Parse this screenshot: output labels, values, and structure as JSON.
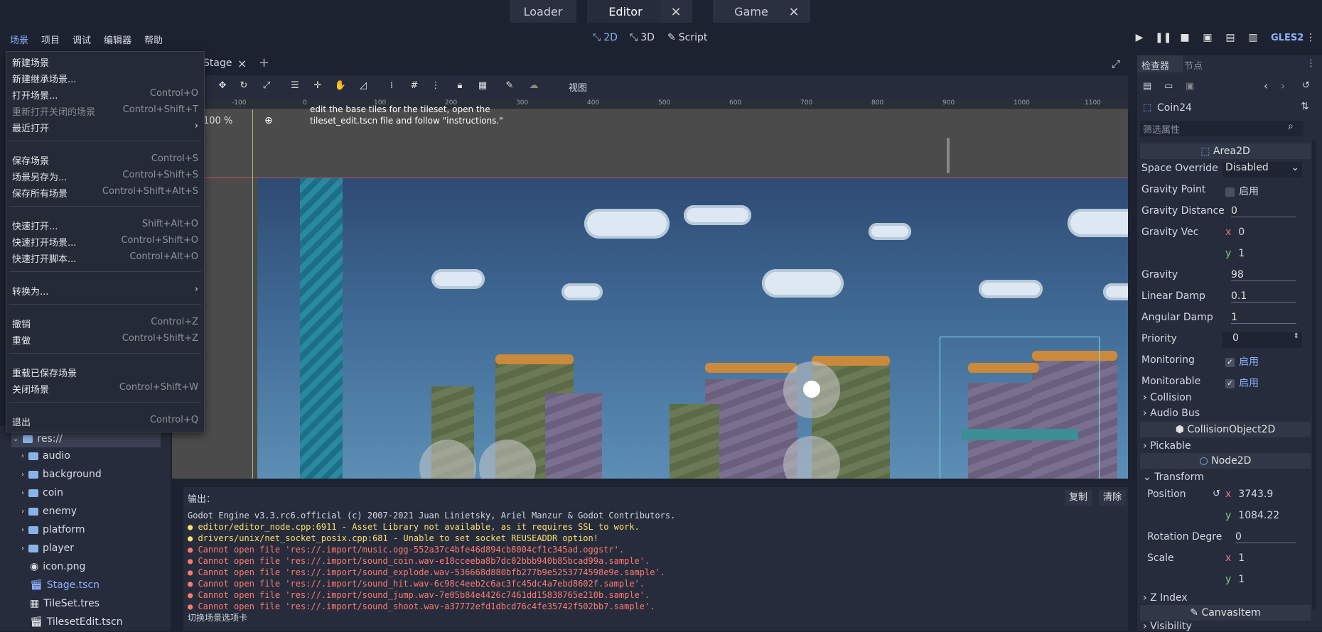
{
  "top_tabs": {
    "loader": "Loader",
    "editor": "Editor",
    "game": "Game",
    "close": "×"
  },
  "menu": {
    "scene": "场景",
    "project": "项目",
    "debug": "调试",
    "editor": "编辑器",
    "help": "帮助"
  },
  "modes": {
    "2d": "2D",
    "3d": "3D",
    "script": "Script"
  },
  "renderer": "GLES2",
  "scene_tab": {
    "name": "Stage",
    "close": "×",
    "add": "+"
  },
  "toolbar": {
    "view": "视图"
  },
  "zoom": "100 %",
  "hint": {
    "line1": "edit the base tiles for the  tileset, open the",
    "line2": "tileset_edit.tscn file and follow \"instructions.\""
  },
  "ruler": [
    "-100",
    "0",
    "100",
    "200",
    "300",
    "400",
    "500",
    "600",
    "700",
    "800",
    "900",
    "1000",
    "1100"
  ],
  "file_menu": [
    {
      "label": "新建场景",
      "shortcut": ""
    },
    {
      "label": "新建继承场景...",
      "shortcut": ""
    },
    {
      "label": "打开场景...",
      "shortcut": "Control+O"
    },
    {
      "label": "重新打开关闭的场景",
      "shortcut": "Control+Shift+T"
    },
    {
      "label": "最近打开",
      "shortcut": "›"
    },
    {
      "label": "保存场景",
      "shortcut": "Control+S"
    },
    {
      "label": "场景另存为...",
      "shortcut": "Control+Shift+S"
    },
    {
      "label": "保存所有场景",
      "shortcut": "Control+Shift+Alt+S"
    },
    {
      "label": "快速打开...",
      "shortcut": "Shift+Alt+O"
    },
    {
      "label": "快速打开场景...",
      "shortcut": "Control+Shift+O"
    },
    {
      "label": "快速打开脚本...",
      "shortcut": "Control+Alt+O"
    },
    {
      "label": "转换为...",
      "shortcut": "›"
    },
    {
      "label": "撤销",
      "shortcut": "Control+Z"
    },
    {
      "label": "重做",
      "shortcut": "Control+Shift+Z"
    },
    {
      "label": "重载已保存场景",
      "shortcut": ""
    },
    {
      "label": "关闭场景",
      "shortcut": "Control+Shift+W"
    },
    {
      "label": "退出",
      "shortcut": "Control+Q"
    }
  ],
  "filesystem": [
    "res://",
    "audio",
    "background",
    "coin",
    "enemy",
    "platform",
    "player",
    "icon.png",
    "Stage.tscn",
    "TileSet.tres",
    "TilesetEdit.tscn"
  ],
  "output": {
    "title": "输出：",
    "copy": "复制",
    "clear": "清除",
    "lines": [
      "Godot Engine v3.3.rc6.official (c) 2007-2021 Juan Linietsky, Ariel Manzur & Godot Contributors.",
      "● editor/editor_node.cpp:6911 - Asset Library not available, as it requires SSL to work.",
      "● drivers/unix/net_socket_posix.cpp:681 - Unable to set socket REUSEADDR option!",
      "● Cannot open file 'res://.import/music.ogg-552a37c4bfe46d894cb8004cf1c345ad.oggstr'.",
      "● Cannot open file 'res://.import/sound_coin.wav-e18cceeba8b7dc02bbb940b85bcad99a.sample'.",
      "● Cannot open file 'res://.import/sound_explode.wav-536668d880bfb277b9e5253774598e9e.sample'.",
      "● Cannot open file 'res://.import/sound_hit.wav-6c98c4eeb2c6ac3fc45dc4a7ebd8602f.sample'.",
      "● Cannot open file 'res://.import/sound_jump.wav-7e05b84e4426c7461dd15838765e210b.sample'.",
      "● Cannot open file 'res://.import/sound_shoot.wav-a37772efd1dbcd76c4fe35742f502bb7.sample'.",
      "切换场景选项卡"
    ]
  },
  "inspector": {
    "tab_inspector": "检查器",
    "tab_node": "节点",
    "node_name": "Coin24",
    "filter_placeholder": "筛选属性",
    "area2d": "Area2D",
    "space_override_label": "Space Override",
    "space_override": "Disabled",
    "gravity_point_label": "Gravity Point",
    "enable": "启用",
    "gravity_distance_label": "Gravity Distance",
    "gravity_distance": "0",
    "gravity_vec_label": "Gravity Vec",
    "gravity_vec_x": "0",
    "gravity_vec_y": "1",
    "gravity_label": "Gravity",
    "gravity": "98",
    "linear_damp_label": "Linear Damp",
    "linear_damp": "0.1",
    "angular_damp_label": "Angular Damp",
    "angular_damp": "1",
    "priority_label": "Priority",
    "priority": "0",
    "monitoring_label": "Monitoring",
    "monitorable_label": "Monitorable",
    "collision": "Collision",
    "audio_bus": "Audio Bus",
    "collision_object": "CollisionObject2D",
    "pickable": "Pickable",
    "node2d": "Node2D",
    "transform": "Transform",
    "position_label": "Position",
    "position_x": "3743.9",
    "position_y": "1084.22",
    "rotation_label": "Rotation Degre",
    "rotation": "0",
    "scale_label": "Scale",
    "scale_x": "1",
    "scale_y": "1",
    "z_index": "Z Index",
    "canvas_item": "CanvasItem",
    "visibility": "Visibility",
    "x": "x",
    "y": "y"
  },
  "colors": {
    "accent": "#8fb0ff",
    "error": "#ff7a70",
    "warning": "#ffdf6e",
    "panel": "#262c3b",
    "background": "#1d2230"
  }
}
